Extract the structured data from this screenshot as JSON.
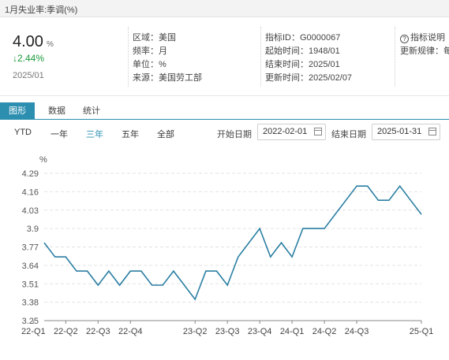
{
  "window": {
    "title": "1月失业率:季调(%)"
  },
  "summary": {
    "value": "4.00",
    "unit": "%",
    "change": "↓2.44%",
    "date": "2025/01",
    "meta_left": [
      {
        "label": "区域：",
        "value": "美国"
      },
      {
        "label": "频率：",
        "value": "月"
      },
      {
        "label": "单位：",
        "value": "%"
      },
      {
        "label": "来源：",
        "value": "美国劳工部"
      }
    ],
    "meta_right": [
      {
        "label": "指标ID：",
        "value": "G0000067"
      },
      {
        "label": "起始时间：",
        "value": "1948/01"
      },
      {
        "label": "结束时间：",
        "value": "2025/01"
      },
      {
        "label": "更新时间：",
        "value": "2025/02/07"
      }
    ],
    "extra": {
      "help_label": "指标说明",
      "update_rule_label": "更新规律：",
      "update_rule_value": "每"
    }
  },
  "tabs": [
    {
      "label": "图形",
      "active": true
    },
    {
      "label": "数据",
      "active": false
    },
    {
      "label": "统计",
      "active": false
    }
  ],
  "ranges": [
    {
      "label": "YTD",
      "active": false
    },
    {
      "label": "一年",
      "active": false
    },
    {
      "label": "三年",
      "active": true
    },
    {
      "label": "五年",
      "active": false
    },
    {
      "label": "全部",
      "active": false
    }
  ],
  "date_range": {
    "start_label": "开始日期",
    "start_value": "2022-02-01",
    "end_label": "结束日期",
    "end_value": "2025-01-31"
  },
  "colors": {
    "accent": "#2c8fb0",
    "line": "#2b7fa3",
    "positive_change": "#1a9b3a"
  },
  "chart_data": {
    "type": "line",
    "ylabel": "%",
    "ylim": [
      3.25,
      4.29
    ],
    "yticks": [
      "3.25",
      "3.38",
      "3.51",
      "3.64",
      "3.77",
      "3.9",
      "4.03",
      "4.16",
      "4.29"
    ],
    "xticks": [
      "22-Q1",
      "22-Q2",
      "22-Q3",
      "22-Q4",
      "23-Q2",
      "23-Q3",
      "23-Q4",
      "24-Q1",
      "24-Q2",
      "24-Q3",
      "25-Q1"
    ],
    "grid": true,
    "legend": "none",
    "series": [
      {
        "x": [
          "2022-02",
          "2022-03",
          "2022-04",
          "2022-05",
          "2022-06",
          "2022-07",
          "2022-08",
          "2022-09",
          "2022-10",
          "2022-11",
          "2022-12",
          "2023-01",
          "2023-02",
          "2023-03",
          "2023-04",
          "2023-05",
          "2023-06",
          "2023-07",
          "2023-08",
          "2023-09",
          "2023-10",
          "2023-11",
          "2023-12",
          "2024-01",
          "2024-02",
          "2024-03",
          "2024-04",
          "2024-05",
          "2024-06",
          "2024-07",
          "2024-08",
          "2024-09",
          "2024-10",
          "2024-11",
          "2024-12",
          "2025-01"
        ],
        "values": [
          3.8,
          3.7,
          3.7,
          3.6,
          3.6,
          3.5,
          3.6,
          3.5,
          3.6,
          3.6,
          3.5,
          3.5,
          3.6,
          3.5,
          3.4,
          3.6,
          3.6,
          3.5,
          3.7,
          3.8,
          3.9,
          3.7,
          3.8,
          3.7,
          3.9,
          3.9,
          3.9,
          4.0,
          4.1,
          4.2,
          4.2,
          4.1,
          4.1,
          4.2,
          4.1,
          4.0
        ]
      }
    ]
  }
}
